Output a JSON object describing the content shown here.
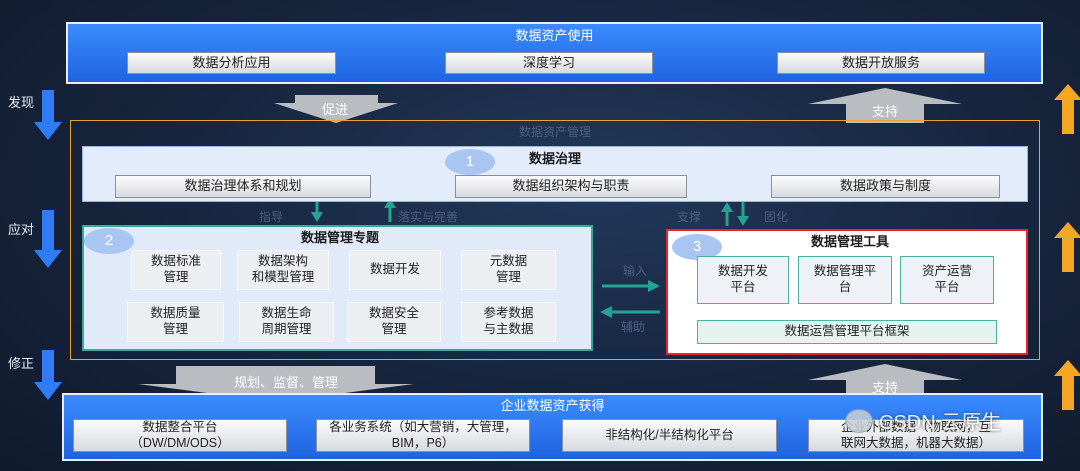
{
  "usage": {
    "title": "数据资产使用",
    "items": [
      "数据分析应用",
      "深度学习",
      "数据开放服务"
    ]
  },
  "side_labels": {
    "discover": "发现",
    "respond": "应对",
    "correct": "修正"
  },
  "arrows": {
    "promote": "促进",
    "support_top": "支持",
    "plan": "规划、监督、管理",
    "support_bottom": "支持"
  },
  "management": {
    "title": "数据资产管理"
  },
  "governance": {
    "number": "1",
    "title": "数据治理",
    "items": [
      "数据治理体系和规划",
      "数据组织架构与职责",
      "数据政策与制度"
    ]
  },
  "links": {
    "guide": "指导",
    "implement": "落实与完善",
    "support": "支撑",
    "solidify": "固化",
    "input": "输入",
    "assist": "辅助"
  },
  "topics": {
    "number": "2",
    "title": "数据管理专题",
    "items": [
      "数据标准\n管理",
      "数据架构\n和模型管理",
      "数据开发",
      "元数据\n管理",
      "数据质量\n管理",
      "数据生命\n周期管理",
      "数据安全\n管理",
      "参考数据\n与主数据"
    ]
  },
  "tools": {
    "number": "3",
    "title": "数据管理工具",
    "items": [
      "数据开发\n平台",
      "数据管理平\n台",
      "资产运营\n平台"
    ],
    "framework": "数据运营管理平台框架"
  },
  "acquire": {
    "title": "企业数据资产获得",
    "items": [
      "数据整合平台\n（DW/DM/ODS）",
      "各业务系统（如大营销，大管理，\nBIM，P6）",
      "非结构化/半结构化平台",
      "企业外部数据（物联网，互\n联网大数据，机器大数据）"
    ]
  },
  "watermark": "CSDN 云原生",
  "colors": {
    "blue": "#2f7cf6",
    "orange": "#f5a623",
    "teal": "#23a392",
    "red": "#e8232a"
  }
}
